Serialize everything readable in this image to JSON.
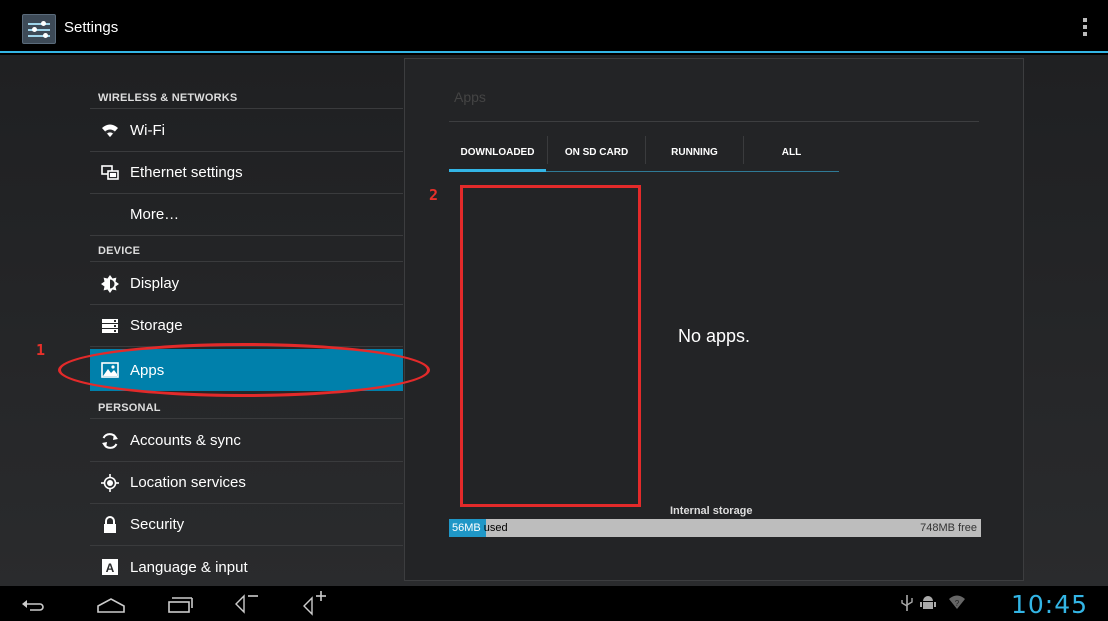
{
  "actionbar": {
    "title": "Settings",
    "app_icon": "settings-sliders-icon",
    "overflow_icon": "overflow-menu-icon"
  },
  "sidebar": {
    "sections": [
      {
        "label": "WIRELESS & NETWORKS"
      },
      {
        "label": "DEVICE"
      },
      {
        "label": "PERSONAL"
      }
    ],
    "items": [
      {
        "label": "Wi-Fi",
        "icon": "wifi-icon"
      },
      {
        "label": "Ethernet settings",
        "icon": "ethernet-icon"
      },
      {
        "label": "More…",
        "icon": ""
      },
      {
        "label": "Display",
        "icon": "display-brightness-icon"
      },
      {
        "label": "Storage",
        "icon": "storage-icon"
      },
      {
        "label": "Apps",
        "icon": "apps-icon",
        "selected": true
      },
      {
        "label": "Accounts & sync",
        "icon": "sync-icon"
      },
      {
        "label": "Location services",
        "icon": "location-icon"
      },
      {
        "label": "Security",
        "icon": "lock-icon"
      },
      {
        "label": "Language & input",
        "icon": "language-icon"
      }
    ]
  },
  "panel": {
    "title": "Apps",
    "tabs": [
      "DOWNLOADED",
      "ON SD CARD",
      "RUNNING",
      "ALL"
    ],
    "active_tab": "DOWNLOADED",
    "empty_text": "No apps.",
    "storage": {
      "label": "Internal storage",
      "used_value": "56MB",
      "used_suffix": " used",
      "free_text": "748MB free",
      "used_fraction": 0.07
    }
  },
  "annotations": {
    "first": "1",
    "second": "2"
  },
  "navbar": {
    "clock": "10:45",
    "buttons": [
      "back-icon",
      "home-icon",
      "recent-apps-icon",
      "volume-down-icon",
      "volume-up-icon"
    ],
    "status_icons": [
      "usb-icon",
      "android-debug-icon",
      "wifi-signal-icon"
    ]
  },
  "colors": {
    "accent": "#33b5e5",
    "selected": "#0080ab",
    "annotation": "#e32a2a"
  }
}
